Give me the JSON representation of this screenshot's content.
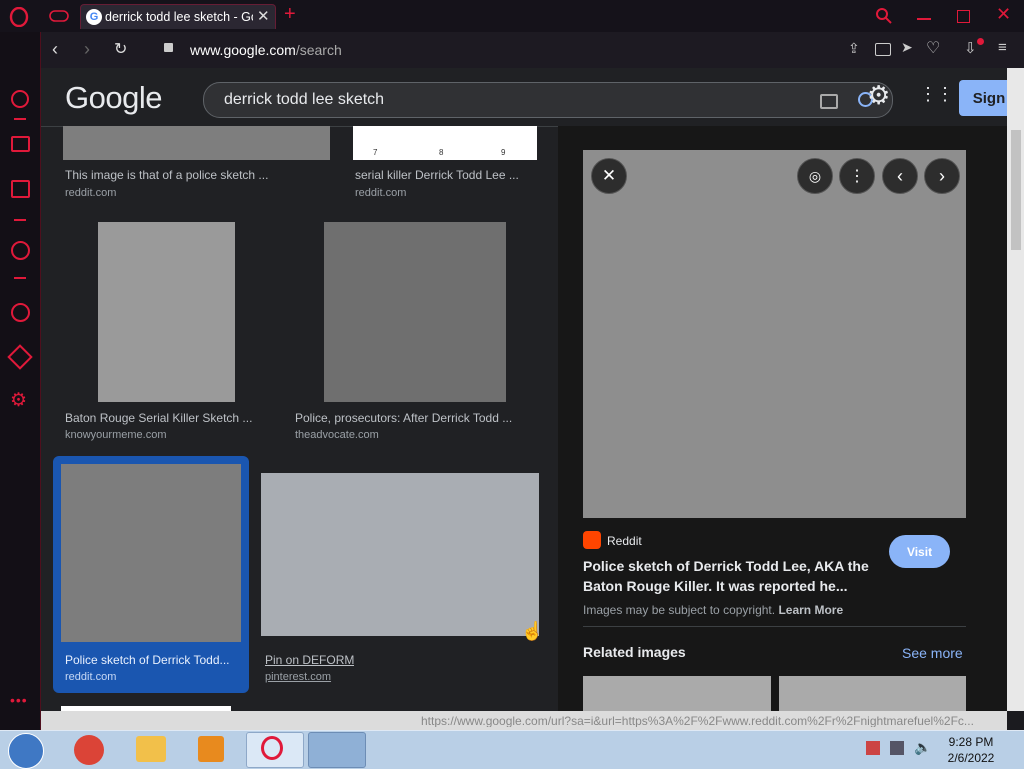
{
  "browser": {
    "tab_title": "derrick todd lee sketch - Go",
    "url_domain": "www.google.com",
    "url_path": "/search",
    "status_url": "https://www.google.com/url?sa=i&url=https%3A%2F%2Fwww.reddit.com%2Fr%2Fnightmarefuel%2Fc..."
  },
  "google": {
    "logo": "Google",
    "query": "derrick todd lee sketch",
    "sign_in": "Sign"
  },
  "results": [
    {
      "caption": "This image is that of a police sketch ...",
      "source": "reddit.com"
    },
    {
      "caption": "serial killer Derrick Todd Lee ...",
      "source": "reddit.com"
    },
    {
      "caption": "Baton Rouge Serial Killer Sketch ...",
      "source": "knowyourmeme.com"
    },
    {
      "caption": "Police, prosecutors: After Derrick Todd ...",
      "source": "theadvocate.com"
    },
    {
      "caption": "Police sketch of Derrick Todd...",
      "source": "reddit.com"
    },
    {
      "caption": "Pin on DEFORM",
      "source": "pinterest.com"
    }
  ],
  "top_strip_numbers": [
    "7",
    "8",
    "9"
  ],
  "preview": {
    "source_name": "Reddit",
    "title": "Police sketch of Derrick Todd Lee, AKA the Baton Rouge Killer. It was reported he...",
    "visit": "Visit",
    "copyright": "Images may be subject to copyright.",
    "learn_more": "Learn More",
    "related_heading": "Related images",
    "see_more": "See more"
  },
  "clock": {
    "time": "9:28 PM",
    "date": "2/6/2022"
  },
  "colors": {
    "opera_red": "#e0193a",
    "link_blue": "#8ab4f8",
    "bg": "#202124"
  }
}
